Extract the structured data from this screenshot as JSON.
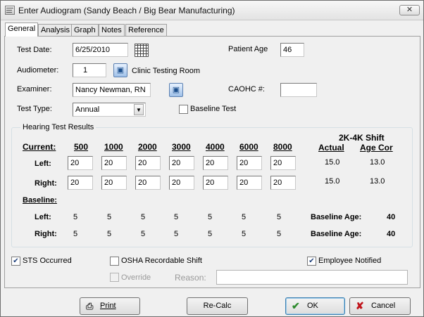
{
  "window": {
    "title": "Enter Audiogram (Sandy Beach / Big Bear Manufacturing)",
    "close_glyph": "✕"
  },
  "tabs": [
    "General",
    "Analysis",
    "Graph",
    "Notes",
    "Reference"
  ],
  "general": {
    "test_date_label": "Test Date:",
    "test_date_value": "6/25/2010",
    "patient_age_label": "Patient Age",
    "patient_age_value": "46",
    "audiometer_label": "Audiometer:",
    "audiometer_value": "1",
    "audiometer_name": "Clinic Testing Room",
    "examiner_label": "Examiner:",
    "examiner_value": "Nancy Newman, RN",
    "caohc_label": "CAOHC #:",
    "caohc_value": "",
    "test_type_label": "Test Type:",
    "test_type_value": "Annual",
    "baseline_test_label": "Baseline Test"
  },
  "results": {
    "group_title": "Hearing Test Results",
    "current_label": "Current:",
    "frequencies": [
      "500",
      "1000",
      "2000",
      "3000",
      "4000",
      "6000",
      "8000"
    ],
    "left_label": "Left:",
    "right_label": "Right:",
    "current_left": [
      "20",
      "20",
      "20",
      "20",
      "20",
      "20",
      "20"
    ],
    "current_right": [
      "20",
      "20",
      "20",
      "20",
      "20",
      "20",
      "20"
    ],
    "shift_header": "2K-4K Shift",
    "actual_label": "Actual",
    "age_cor_label": "Age Cor",
    "left_actual": "15.0",
    "left_age_cor": "13.0",
    "right_actual": "15.0",
    "right_age_cor": "13.0",
    "baseline_label": "Baseline:",
    "baseline_left": [
      "5",
      "5",
      "5",
      "5",
      "5",
      "5",
      "5"
    ],
    "baseline_right": [
      "5",
      "5",
      "5",
      "5",
      "5",
      "5",
      "5"
    ],
    "baseline_age_label": "Baseline Age:",
    "baseline_age_left": "40",
    "baseline_age_right": "40"
  },
  "flags": {
    "sts_label": "STS Occurred",
    "sts_checked": true,
    "osha_label": "OSHA Recordable Shift",
    "osha_checked": false,
    "notified_label": "Employee Notified",
    "notified_checked": true,
    "override_label": "Override",
    "reason_label": "Reason:",
    "reason_value": ""
  },
  "buttons": {
    "print": "Print",
    "recalc": "Re-Calc",
    "ok": "OK",
    "cancel": "Cancel"
  },
  "colors": {
    "ok_check": "#2e8b2e",
    "cancel_x": "#c0141b",
    "accent": "#1c4f8c"
  }
}
